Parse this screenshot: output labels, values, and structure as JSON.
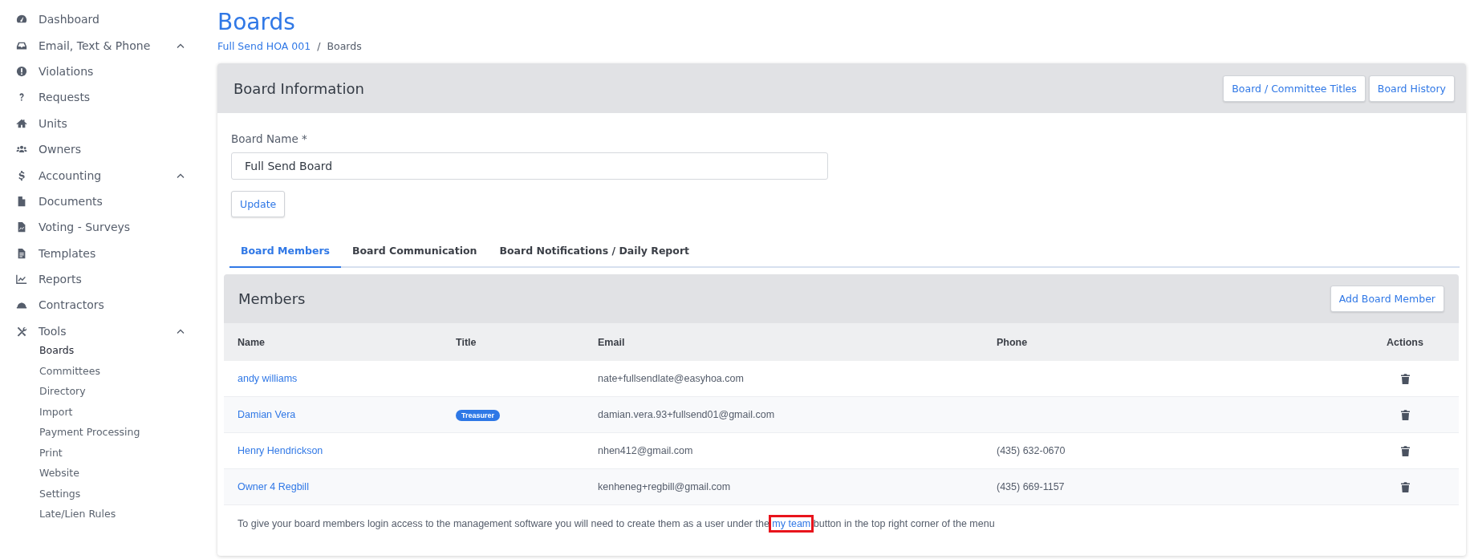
{
  "sidebar": {
    "items": [
      {
        "label": "Dashboard"
      },
      {
        "label": "Email, Text & Phone",
        "expanded": true
      },
      {
        "label": "Violations"
      },
      {
        "label": "Requests"
      },
      {
        "label": "Units"
      },
      {
        "label": "Owners"
      },
      {
        "label": "Accounting",
        "expanded": true
      },
      {
        "label": "Documents"
      },
      {
        "label": "Voting - Surveys"
      },
      {
        "label": "Templates"
      },
      {
        "label": "Reports"
      },
      {
        "label": "Contractors"
      },
      {
        "label": "Tools",
        "expanded": true,
        "children": [
          {
            "label": "Boards",
            "selected": true
          },
          {
            "label": "Committees",
            "selected": false
          },
          {
            "label": "Directory",
            "selected": false
          },
          {
            "label": "Import",
            "selected": false
          },
          {
            "label": "Payment Processing",
            "selected": false
          },
          {
            "label": "Print",
            "selected": false
          },
          {
            "label": "Website",
            "selected": false
          },
          {
            "label": "Settings",
            "selected": false
          },
          {
            "label": "Late/Lien Rules",
            "selected": false
          }
        ]
      }
    ]
  },
  "page": {
    "title": "Boards",
    "breadcrumb_separator": "/",
    "breadcrumb": [
      {
        "label": "Full Send HOA 001",
        "link": true
      },
      {
        "label": "Boards",
        "link": false
      }
    ]
  },
  "board_information": {
    "title": "Board Information",
    "buttons": [
      "Board / Committee Titles",
      "Board History"
    ],
    "field": {
      "label": "Board Name *",
      "value": "Full Send Board"
    },
    "update_button": "Update"
  },
  "tabs": [
    {
      "label": "Board Members",
      "selected": true
    },
    {
      "label": "Board Communication",
      "selected": false
    },
    {
      "label": "Board Notifications / Daily Report",
      "selected": false
    }
  ],
  "members": {
    "title": "Members",
    "add_button": "Add Board Member",
    "columns": [
      "Name",
      "Title",
      "Email",
      "Phone",
      "Actions"
    ],
    "rows": [
      {
        "name": "andy williams",
        "email": "nate+fullsendlate@easyhoa.com"
      },
      {
        "name": "Damian Vera",
        "title": "Treasurer",
        "email": "damian.vera.93+fullsend01@gmail.com"
      },
      {
        "name": "Henry Hendrickson",
        "email": "nhen412@gmail.com",
        "phone": "(435) 632-0670"
      },
      {
        "name": "Owner 4 Regbill",
        "email": "kenheneg+regbill@gmail.com",
        "phone": "(435) 669-1157"
      }
    ],
    "note": {
      "before": "To give your board members login access to the management software you will need to create them as a user under the",
      "link": "my team",
      "link_highlighted": true,
      "after": "button in the top right corner of the menu"
    }
  }
}
